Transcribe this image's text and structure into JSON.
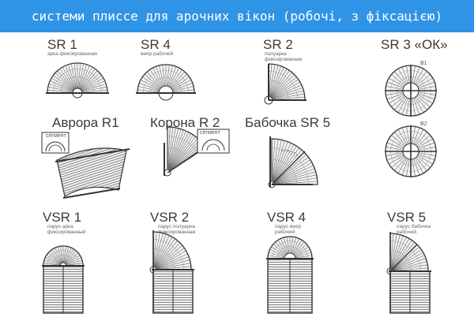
{
  "title": "системи плиссе для арочних вікон (робочі, з фіксацією)",
  "items": [
    {
      "code": "SR 1",
      "desc": "арка фиксированная"
    },
    {
      "code": "SR 4",
      "desc": "веер рабочий"
    },
    {
      "code": "SR 2",
      "desc1": "полуарка",
      "desc2": "фиксированная"
    },
    {
      "code": "SR 3 «ОК»",
      "b1": "B1",
      "b2": "B2"
    },
    {
      "code": "Аврора R1",
      "tag": "сегмент"
    },
    {
      "code": "Корона R 2",
      "tag": "сегмент"
    },
    {
      "code": "Бабочка SR 5"
    },
    {
      "code": "VSR 1",
      "desc1": "парус арка",
      "desc2": "фиксированный"
    },
    {
      "code": "VSR 2",
      "desc1": "парус полуарка",
      "desc2": "фиксированная"
    },
    {
      "code": "VSR 4",
      "desc1": "парус веер",
      "desc2": "рабочий"
    },
    {
      "code": "VSR 5",
      "desc1": "парус бабочка",
      "desc2": "рабочий"
    }
  ]
}
